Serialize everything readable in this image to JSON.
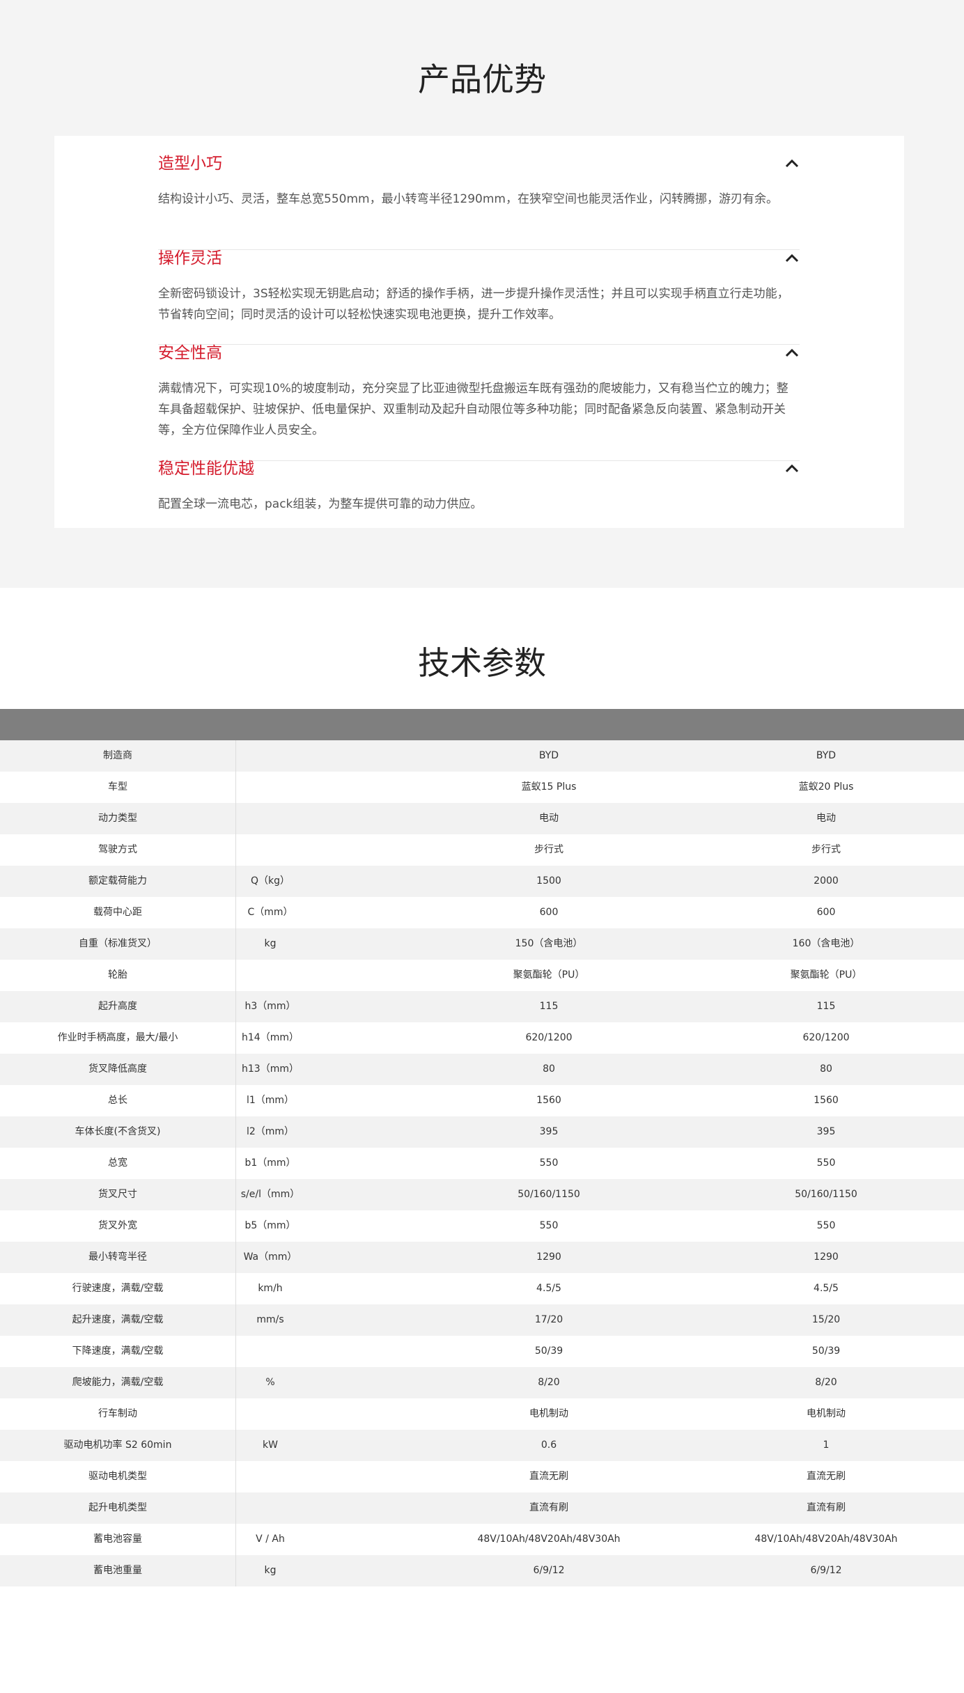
{
  "advantages": {
    "title": "产品优势",
    "items": [
      {
        "title": "造型小巧",
        "desc": "结构设计小巧、灵活，整车总宽550mm，最小转弯半径1290mm，在狭窄空间也能灵活作业，闪转腾挪，游刃有余。",
        "icon": "chevron-up-icon"
      },
      {
        "title": "操作灵活",
        "desc": "全新密码锁设计，3S轻松实现无钥匙启动；舒适的操作手柄，进一步提升操作灵活性；并且可以实现手柄直立行走功能，节省转向空间；同时灵活的设计可以轻松快速实现电池更换，提升工作效率。",
        "icon": "chevron-up-icon"
      },
      {
        "title": "安全性高",
        "desc": "满载情况下，可实现10%的坡度制动，充分突显了比亚迪微型托盘搬运车既有强劲的爬坡能力，又有稳当伫立的魄力；整车具备超载保护、驻坡保护、低电量保护、双重制动及起升自动限位等多种功能；同时配备紧急反向装置、紧急制动开关等，全方位保障作业人员安全。",
        "icon": "chevron-up-icon"
      },
      {
        "title": "稳定性能优越",
        "desc": "配置全球一流电芯，pack组装，为整车提供可靠的动力供应。",
        "icon": "chevron-up-icon"
      }
    ]
  },
  "specs": {
    "title": "技术参数",
    "rows": [
      {
        "name": "制造商",
        "unit": "",
        "v1": "BYD",
        "v2": "BYD"
      },
      {
        "name": "车型",
        "unit": "",
        "v1": "蓝蚁15 Plus",
        "v2": "蓝蚁20 Plus"
      },
      {
        "name": "动力类型",
        "unit": "",
        "v1": "电动",
        "v2": "电动"
      },
      {
        "name": "驾驶方式",
        "unit": "",
        "v1": "步行式",
        "v2": "步行式"
      },
      {
        "name": "额定载荷能力",
        "unit": "Q（kg）",
        "v1": "1500",
        "v2": "2000"
      },
      {
        "name": "载荷中心距",
        "unit": "C（mm）",
        "v1": "600",
        "v2": "600"
      },
      {
        "name": "自重（标准货叉）",
        "unit": "kg",
        "v1": "150（含电池）",
        "v2": "160（含电池）"
      },
      {
        "name": "轮胎",
        "unit": "",
        "v1": "聚氨酯轮（PU）",
        "v2": "聚氨酯轮（PU）"
      },
      {
        "name": "起升高度",
        "unit": "h3（mm）",
        "v1": "115",
        "v2": "115"
      },
      {
        "name": "作业时手柄高度，最大/最小",
        "unit": "h14（mm）",
        "v1": "620/1200",
        "v2": "620/1200"
      },
      {
        "name": "货叉降低高度",
        "unit": "h13（mm）",
        "v1": "80",
        "v2": "80"
      },
      {
        "name": "总长",
        "unit": "l1（mm）",
        "v1": "1560",
        "v2": "1560"
      },
      {
        "name": "车体长度(不含货叉)",
        "unit": "l2（mm）",
        "v1": "395",
        "v2": "395"
      },
      {
        "name": "总宽",
        "unit": "b1（mm）",
        "v1": "550",
        "v2": "550"
      },
      {
        "name": "货叉尺寸",
        "unit": "s/e/l（mm）",
        "v1": "50/160/1150",
        "v2": "50/160/1150"
      },
      {
        "name": "货叉外宽",
        "unit": "b5（mm）",
        "v1": "550",
        "v2": "550"
      },
      {
        "name": "最小转弯半径",
        "unit": "Wa（mm）",
        "v1": "1290",
        "v2": "1290"
      },
      {
        "name": "行驶速度，满载/空载",
        "unit": "km/h",
        "v1": "4.5/5",
        "v2": "4.5/5"
      },
      {
        "name": "起升速度，满载/空载",
        "unit": "mm/s",
        "v1": "17/20",
        "v2": "15/20"
      },
      {
        "name": "下降速度，满载/空载",
        "unit": "",
        "v1": "50/39",
        "v2": "50/39"
      },
      {
        "name": "爬坡能力，满载/空载",
        "unit": "%",
        "v1": "8/20",
        "v2": "8/20"
      },
      {
        "name": "行车制动",
        "unit": "",
        "v1": "电机制动",
        "v2": "电机制动"
      },
      {
        "name": "驱动电机功率  S2 60min",
        "unit": "kW",
        "v1": "0.6",
        "v2": "1"
      },
      {
        "name": "驱动电机类型",
        "unit": "",
        "v1": "直流无刷",
        "v2": "直流无刷"
      },
      {
        "name": "起升电机类型",
        "unit": "",
        "v1": "直流有刷",
        "v2": "直流有刷"
      },
      {
        "name": "蓄电池容量",
        "unit": "V / Ah",
        "v1": "48V/10Ah/48V20Ah/48V30Ah",
        "v2": "48V/10Ah/48V20Ah/48V30Ah"
      },
      {
        "name": "蓄电池重量",
        "unit": "kg",
        "v1": "6/9/12",
        "v2": "6/9/12"
      }
    ]
  },
  "colors": {
    "accent": "#d41b2c",
    "section_bg": "#f4f4f4",
    "header_bar": "#7f7f7f",
    "row_shade": "#f2f2f2"
  }
}
